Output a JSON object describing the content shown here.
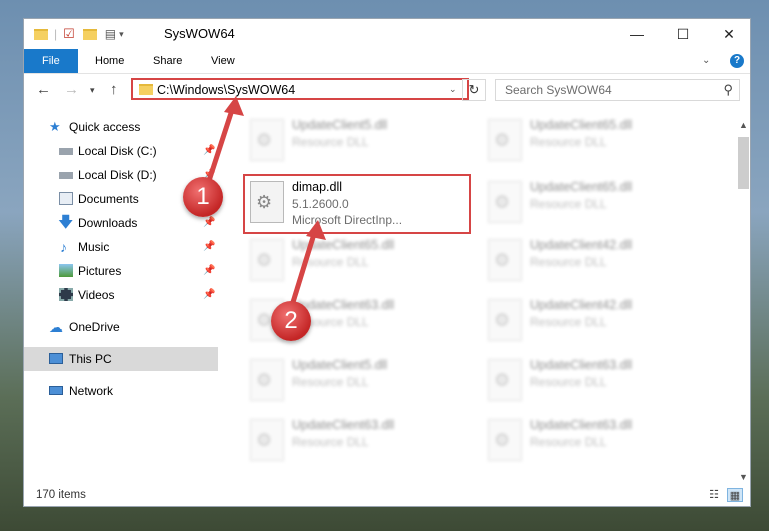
{
  "window": {
    "title": "SysWOW64",
    "controls": {
      "minimize": "—",
      "maximize": "☐",
      "close": "✕"
    }
  },
  "ribbon": {
    "tabs": [
      "File",
      "Home",
      "Share",
      "View"
    ],
    "help_glyph": "?"
  },
  "address": {
    "path": "C:\\Windows\\SysWOW64",
    "search_placeholder": "Search SysWOW64"
  },
  "sidebar": {
    "items": [
      {
        "label": "Quick access",
        "icon": "star-icon",
        "pinned": false
      },
      {
        "label": "Local Disk (C:)",
        "icon": "drive-icon",
        "pinned": true
      },
      {
        "label": "Local Disk (D:)",
        "icon": "drive-icon",
        "pinned": true
      },
      {
        "label": "Documents",
        "icon": "documents-icon",
        "pinned": true
      },
      {
        "label": "Downloads",
        "icon": "download-icon",
        "pinned": true
      },
      {
        "label": "Music",
        "icon": "music-icon",
        "pinned": true
      },
      {
        "label": "Pictures",
        "icon": "pictures-icon",
        "pinned": true
      },
      {
        "label": "Videos",
        "icon": "videos-icon",
        "pinned": true
      },
      {
        "label": "OneDrive",
        "icon": "cloud-icon",
        "pinned": false
      },
      {
        "label": "This PC",
        "icon": "computer-icon",
        "pinned": false,
        "selected": true
      },
      {
        "label": "Network",
        "icon": "network-icon",
        "pinned": false
      }
    ]
  },
  "files": {
    "highlighted": {
      "name": "dimap.dll",
      "version": "5.1.2600.0",
      "description": "Microsoft DirectInp..."
    },
    "background": [
      {
        "name": "UpdateClient5.dll",
        "type": "Resource DLL"
      },
      {
        "name": "UpdateClient65.dll",
        "type": "Resource DLL"
      },
      {
        "name": "UpdateClient65.dll",
        "type": "Resource DLL"
      },
      {
        "name": "UpdateClient65.dll",
        "type": "Resource DLL"
      },
      {
        "name": "UpdateClient42.dll",
        "type": "Resource DLL"
      },
      {
        "name": "UpdateClient63.dll",
        "type": "Resource DLL"
      },
      {
        "name": "UpdateClient42.dll",
        "type": "Resource DLL"
      },
      {
        "name": "UpdateClient5.dll",
        "type": "Resource DLL"
      },
      {
        "name": "UpdateClient63.dll",
        "type": "Resource DLL"
      },
      {
        "name": "UpdateClient63.dll",
        "type": "Resource DLL"
      },
      {
        "name": "UpdateClient63.dll",
        "type": "Resource DLL"
      }
    ]
  },
  "status": {
    "item_count": "170 items"
  },
  "annotations": {
    "step1": "1",
    "step2": "2",
    "color": "#d64545"
  }
}
